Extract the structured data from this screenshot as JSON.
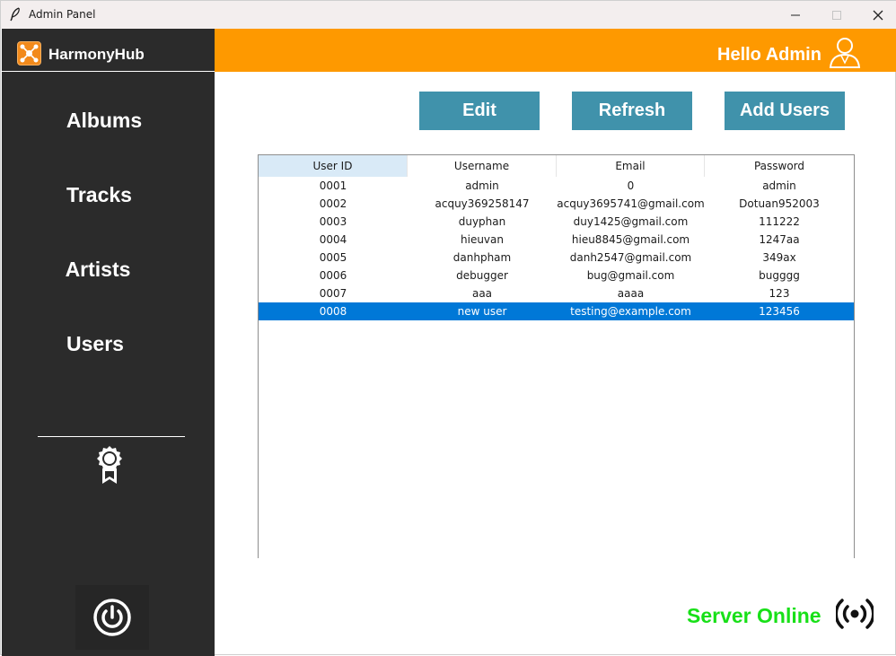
{
  "window": {
    "title": "Admin Panel"
  },
  "brand": {
    "name": "HarmonyHub"
  },
  "nav": {
    "albums": "Albums",
    "tracks": "Tracks",
    "artists": "Artists",
    "users": "Users"
  },
  "header": {
    "greeting": "Hello Admin"
  },
  "toolbar": {
    "edit_label": "Edit",
    "refresh_label": "Refresh",
    "add_label": "Add Users"
  },
  "table": {
    "columns": [
      "User ID",
      "Username",
      "Email",
      "Password"
    ],
    "rows": [
      [
        "0001",
        "admin",
        "0",
        "admin"
      ],
      [
        "0002",
        "acquy369258147",
        "acquy3695741@gmail.com",
        "Dotuan952003"
      ],
      [
        "0003",
        "duyphan",
        "duy1425@gmail.com",
        "111222"
      ],
      [
        "0004",
        "hieuvan",
        "hieu8845@gmail.com",
        "1247aa"
      ],
      [
        "0005",
        "danhpham",
        "danh2547@gmail.com",
        "349ax"
      ],
      [
        "0006",
        "debugger",
        "bug@gmail.com",
        "bugggg"
      ],
      [
        "0007",
        "aaa",
        "aaaa",
        "123"
      ],
      [
        "0008",
        "new user",
        "testing@example.com",
        "123456"
      ]
    ],
    "selected_row": 7
  },
  "status": {
    "text": "Server Online"
  },
  "colors": {
    "header": "#fe9900",
    "sidebar": "#2b2b2b",
    "button": "#4092ab",
    "selection": "#0078d7",
    "status": "#18e018"
  },
  "icons": [
    "feather-icon",
    "harmonyhub-logo-icon",
    "user-outline-icon",
    "award-badge-icon",
    "power-icon",
    "broadcast-signal-icon"
  ]
}
